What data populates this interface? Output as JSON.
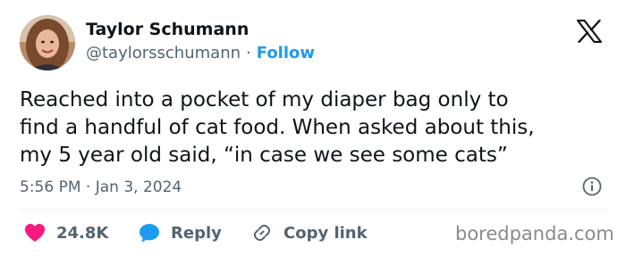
{
  "author": {
    "display_name": "Taylor Schumann",
    "handle": "@taylorsschumann",
    "separator": "·",
    "follow_label": "Follow",
    "avatar_icon": "avatar-photo"
  },
  "tweet": {
    "lines": [
      "Reached into a pocket of my diaper bag only to",
      "find a handful of cat food. When asked about this,",
      "my 5 year old said, “in case we see some cats”"
    ],
    "timestamp": "5:56 PM · Jan 3, 2024"
  },
  "actions": {
    "like_count": "24.8K",
    "reply_label": "Reply",
    "copy_link_label": "Copy link"
  },
  "icons": {
    "logo": "x-logo-icon",
    "info": "info-icon",
    "like": "heart-icon",
    "reply": "chat-bubble-icon",
    "copy": "link-icon"
  },
  "colors": {
    "text": "#0f1419",
    "secondary": "#536471",
    "follow": "#1d9bf0",
    "heart": "#f91880",
    "reply_bubble": "#1d9bf0"
  },
  "watermark": "boredpanda.com"
}
